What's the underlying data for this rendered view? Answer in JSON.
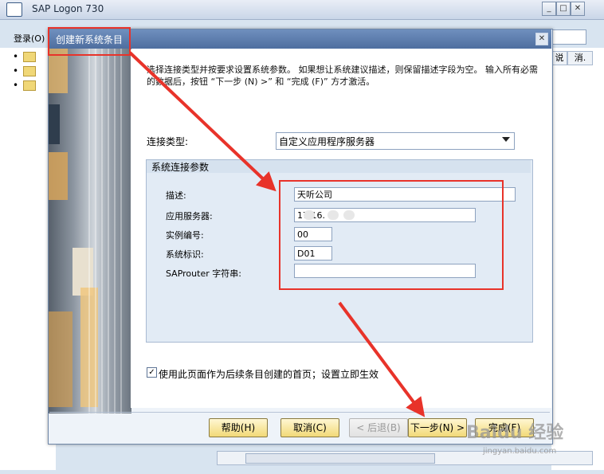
{
  "window": {
    "title": "SAP Logon 730"
  },
  "menu": {
    "login": "登录(O)"
  },
  "columns": [
    "说",
    "消."
  ],
  "dialog": {
    "title": "创建新系统条目",
    "instructions": "选择连接类型并按要求设置系统参数。 如果想让系统建议描述，则保留描述字段为空。 输入所有必需的数据后，按钮 “下一步 (N) >” 和 “完成 (F)” 方才激活。",
    "connection_type_label": "连接类型:",
    "connection_type_value": "自定义应用程序服务器",
    "group_title": "系统连接参数",
    "fields": {
      "description_label": "描述:",
      "description_value": "天听公司",
      "app_server_label": "应用服务器:",
      "app_server_value": "17  16.  .3",
      "instance_label": "实例编号:",
      "instance_value": "00",
      "system_id_label": "系统标识:",
      "system_id_value": "D01",
      "saprouter_label": "SAProuter 字符串:",
      "saprouter_value": ""
    },
    "checkbox_label": "使用此页面作为后续条目创建的首页；设置立即生效",
    "checkbox_checked": true,
    "buttons": {
      "help": "帮助(H)",
      "cancel": "取消(C)",
      "back": "< 后退(B)",
      "next": "下一步(N) >",
      "finish": "完成(F)"
    }
  },
  "watermark": {
    "main": "Baidu 经验",
    "sub": "jingyan.baidu.com"
  },
  "colors": {
    "annotation": "#e8332a",
    "button": "#f2d978",
    "dialog_title": "#4e6e9f"
  }
}
